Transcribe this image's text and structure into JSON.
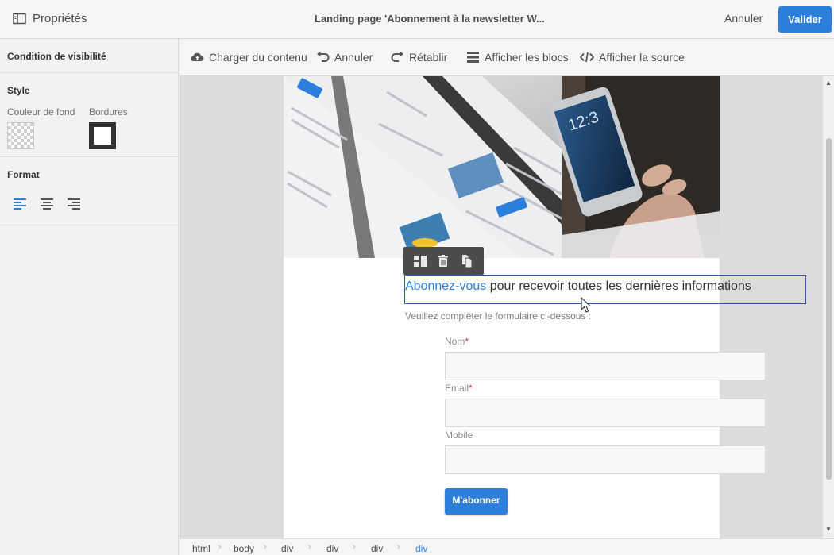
{
  "header": {
    "panel_title": "Propriétés",
    "page_title": "Landing page 'Abonnement à la newsletter W...",
    "cancel_label": "Annuler",
    "validate_label": "Valider"
  },
  "left_panel": {
    "visibility_label": "Condition de visibilité",
    "style_label": "Style",
    "bg_color_label": "Couleur de fond",
    "borders_label": "Bordures",
    "format_label": "Format"
  },
  "toolbar": {
    "load_content": "Charger du contenu",
    "undo": "Annuler",
    "redo": "Rétablir",
    "show_blocks": "Afficher les blocs",
    "show_source": "Afficher la source"
  },
  "content": {
    "heading_accent": "Abonnez-vous",
    "heading_rest": " pour recevoir toutes les dernières informations",
    "intro": "Veuillez compléter le formulaire ci-dessous :",
    "fields": [
      {
        "label": "Nom",
        "required": "*"
      },
      {
        "label": "Email",
        "required": "*"
      },
      {
        "label": "Mobile",
        "required": ""
      }
    ],
    "submit_label": "M'abonner"
  },
  "breadcrumb": [
    "html",
    "body",
    "div",
    "div",
    "div",
    "div"
  ],
  "colors": {
    "accent": "#2d7fdc",
    "required": "#e22d2d",
    "selection_border": "#2d5aa8"
  }
}
